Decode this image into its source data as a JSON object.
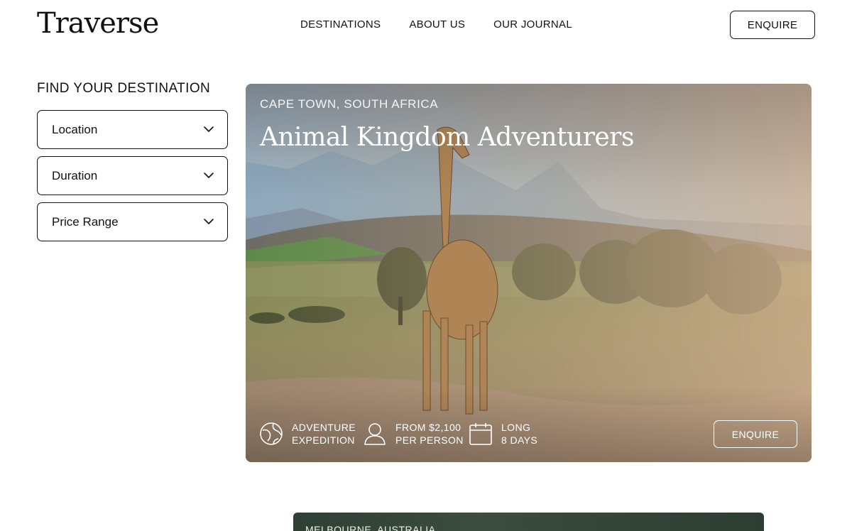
{
  "brand": {
    "logo": "Traverse"
  },
  "nav": {
    "items": [
      {
        "label": "DESTINATIONS"
      },
      {
        "label": "ABOUT US"
      },
      {
        "label": "OUR JOURNAL"
      }
    ],
    "enquire_label": "ENQUIRE"
  },
  "sidebar": {
    "title": "FIND YOUR DESTINATION",
    "filters": [
      {
        "label": "Location",
        "icon": "chevron-down-icon"
      },
      {
        "label": "Duration",
        "icon": "chevron-down-icon"
      },
      {
        "label": "Price Range",
        "icon": "chevron-down-icon"
      }
    ]
  },
  "featured": {
    "location": "CAPE TOWN, SOUTH AFRICA",
    "title": "Animal Kingdom Adventurers",
    "meta": [
      {
        "icon": "globe-icon",
        "line1": "ADVENTURE",
        "line2": "EXPEDITION"
      },
      {
        "icon": "person-icon",
        "line1": "FROM $2,100",
        "line2": "PER PERSON"
      },
      {
        "icon": "calendar-icon",
        "line1": "LONG",
        "line2": "8 DAYS"
      }
    ],
    "enquire_label": "ENQUIRE"
  },
  "next_card": {
    "location": "MELBOURNE, AUSTRALIA"
  },
  "colors": {
    "text": "#111111",
    "border": "#111111",
    "card_text": "#ffffff"
  }
}
